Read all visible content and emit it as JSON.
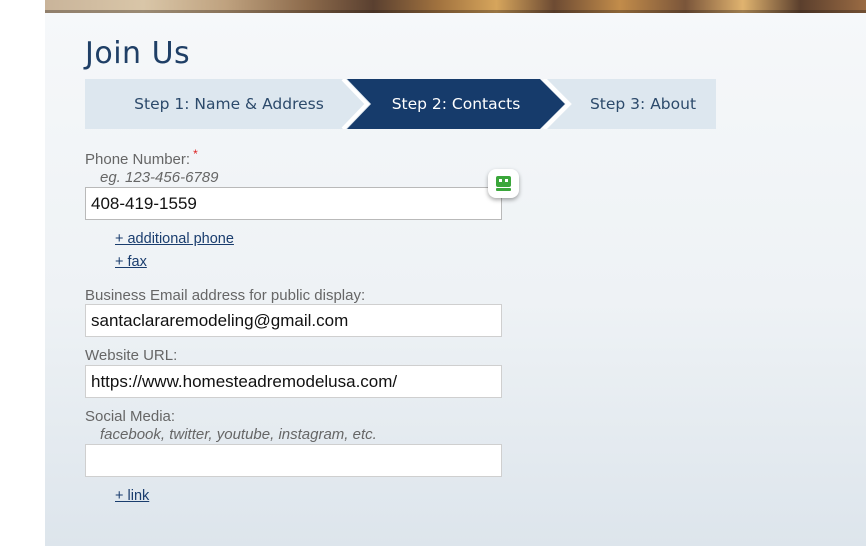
{
  "page": {
    "title": "Join Us"
  },
  "steps": [
    {
      "label": "Step 1: Name & Address",
      "state": "inactive"
    },
    {
      "label": "Step 2: Contacts",
      "state": "active"
    },
    {
      "label": "Step 3: About",
      "state": "inactive"
    }
  ],
  "colors": {
    "title": "#1f3f66",
    "step_active": "#163b6b",
    "step_inactive": "#dde7ef",
    "required_marker": "#dd2222",
    "link": "#1a3d6e",
    "widget_icon": "#3aa63a"
  },
  "form": {
    "phone": {
      "label": "Phone Number:",
      "required_marker": "*",
      "hint": "eg. 123-456-6789",
      "value": "408-419-1559"
    },
    "add_phone_link": "+ additional phone",
    "add_fax_link": "+ fax",
    "email": {
      "label": "Business Email address for public display:",
      "value": "santaclararemodeling@gmail.com"
    },
    "website": {
      "label": "Website URL:",
      "value": "https://www.homesteadremodelusa.com/"
    },
    "social": {
      "label": "Social Media:",
      "hint": "facebook, twitter, youtube, instagram, etc.",
      "value": ""
    },
    "add_link": "+ link"
  },
  "icons": {
    "banner": "photo-banner",
    "autofill_widget": "password-manager-icon"
  }
}
